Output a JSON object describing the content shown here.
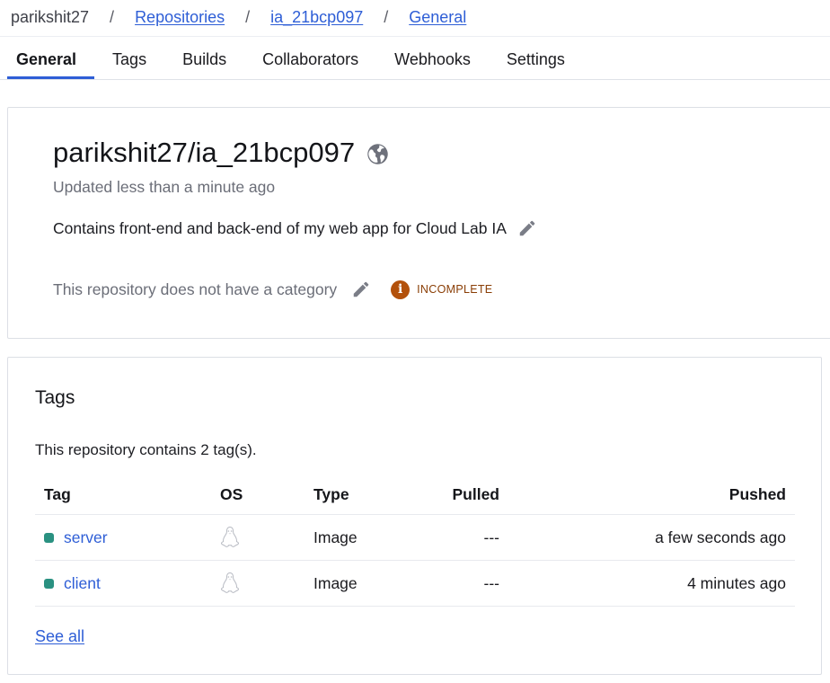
{
  "breadcrumb": {
    "owner": "parikshit27",
    "separator": "/",
    "repositories": "Repositories",
    "repo": "ia_21bcp097",
    "current": "General"
  },
  "tabs": [
    {
      "label": "General",
      "active": true
    },
    {
      "label": "Tags",
      "active": false
    },
    {
      "label": "Builds",
      "active": false
    },
    {
      "label": "Collaborators",
      "active": false
    },
    {
      "label": "Webhooks",
      "active": false
    },
    {
      "label": "Settings",
      "active": false
    }
  ],
  "repo": {
    "title": "parikshit27/ia_21bcp097",
    "visibility_icon": "globe-icon",
    "updated": "Updated less than a minute ago",
    "description": "Contains front-end and back-end of my web app for Cloud Lab IA",
    "category_text": "This repository does not have a category",
    "badge": {
      "icon": "info-icon",
      "text": "INCOMPLETE",
      "color": "#b3510b"
    }
  },
  "tags_section": {
    "title": "Tags",
    "summary": "This repository contains 2 tag(s).",
    "columns": {
      "tag": "Tag",
      "os": "OS",
      "type": "Type",
      "pulled": "Pulled",
      "pushed": "Pushed"
    },
    "rows": [
      {
        "tag": "server",
        "os_icon": "linux-icon",
        "type": "Image",
        "pulled": "---",
        "pushed": "a few seconds ago"
      },
      {
        "tag": "client",
        "os_icon": "linux-icon",
        "type": "Image",
        "pulled": "---",
        "pushed": "4 minutes ago"
      }
    ],
    "see_all": "See all"
  },
  "colors": {
    "link": "#2e5ed6",
    "tag_dot": "#2a9181",
    "badge_text": "#8a3e06"
  }
}
